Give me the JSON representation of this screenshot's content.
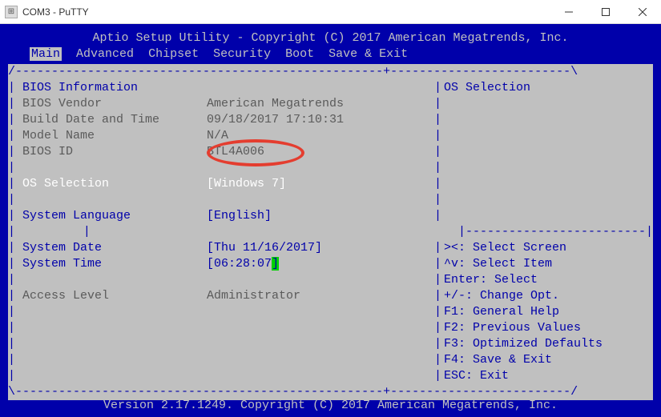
{
  "window": {
    "title": "COM3 - PuTTY"
  },
  "header": {
    "copyright": "Aptio Setup Utility - Copyright (C) 2017 American Megatrends, Inc."
  },
  "tabs": {
    "main": "Main",
    "advanced": "Advanced",
    "chipset": "Chipset",
    "security": "Security",
    "boot": "Boot",
    "save_exit": "Save & Exit"
  },
  "left": {
    "bios_info_hdr": "BIOS Information",
    "bios_vendor_label": "BIOS Vendor",
    "bios_vendor_value": "American Megatrends",
    "build_date_label": "Build Date and Time",
    "build_date_value": "09/18/2017 17:10:31",
    "model_name_label": "Model Name",
    "model_name_value": "N/A",
    "bios_id_label": "BIOS ID",
    "bios_id_value": "BTL4A006",
    "os_selection_label": "OS Selection",
    "os_selection_value": "[Windows 7]",
    "sys_lang_label": "System Language",
    "sys_lang_value": "[English]",
    "sys_date_label": "System Date",
    "sys_date_value": "[Thu 11/16/2017]",
    "sys_time_label": "System Time",
    "sys_time_prefix": "[06:28:07",
    "sys_time_suffix": "]",
    "access_level_label": "Access Level",
    "access_level_value": "Administrator"
  },
  "right": {
    "help_title": "OS Selection",
    "k1": "><: Select Screen",
    "k2": "^v: Select Item",
    "k3": "Enter: Select",
    "k4": "+/-: Change Opt.",
    "k5": "F1: General Help",
    "k6": "F2: Previous Values",
    "k7": "F3: Optimized Defaults",
    "k8": "F4: Save & Exit",
    "k9": "ESC: Exit"
  },
  "footer": {
    "version": "Version 2.17.1249. Copyright (C) 2017 American Megatrends, Inc."
  },
  "borders": {
    "top": "/---------------------------------------------------+-------------------------\\",
    "mid": "|                                                   |-------------------------|",
    "bot": "\\---------------------------------------------------+-------------------------/"
  }
}
